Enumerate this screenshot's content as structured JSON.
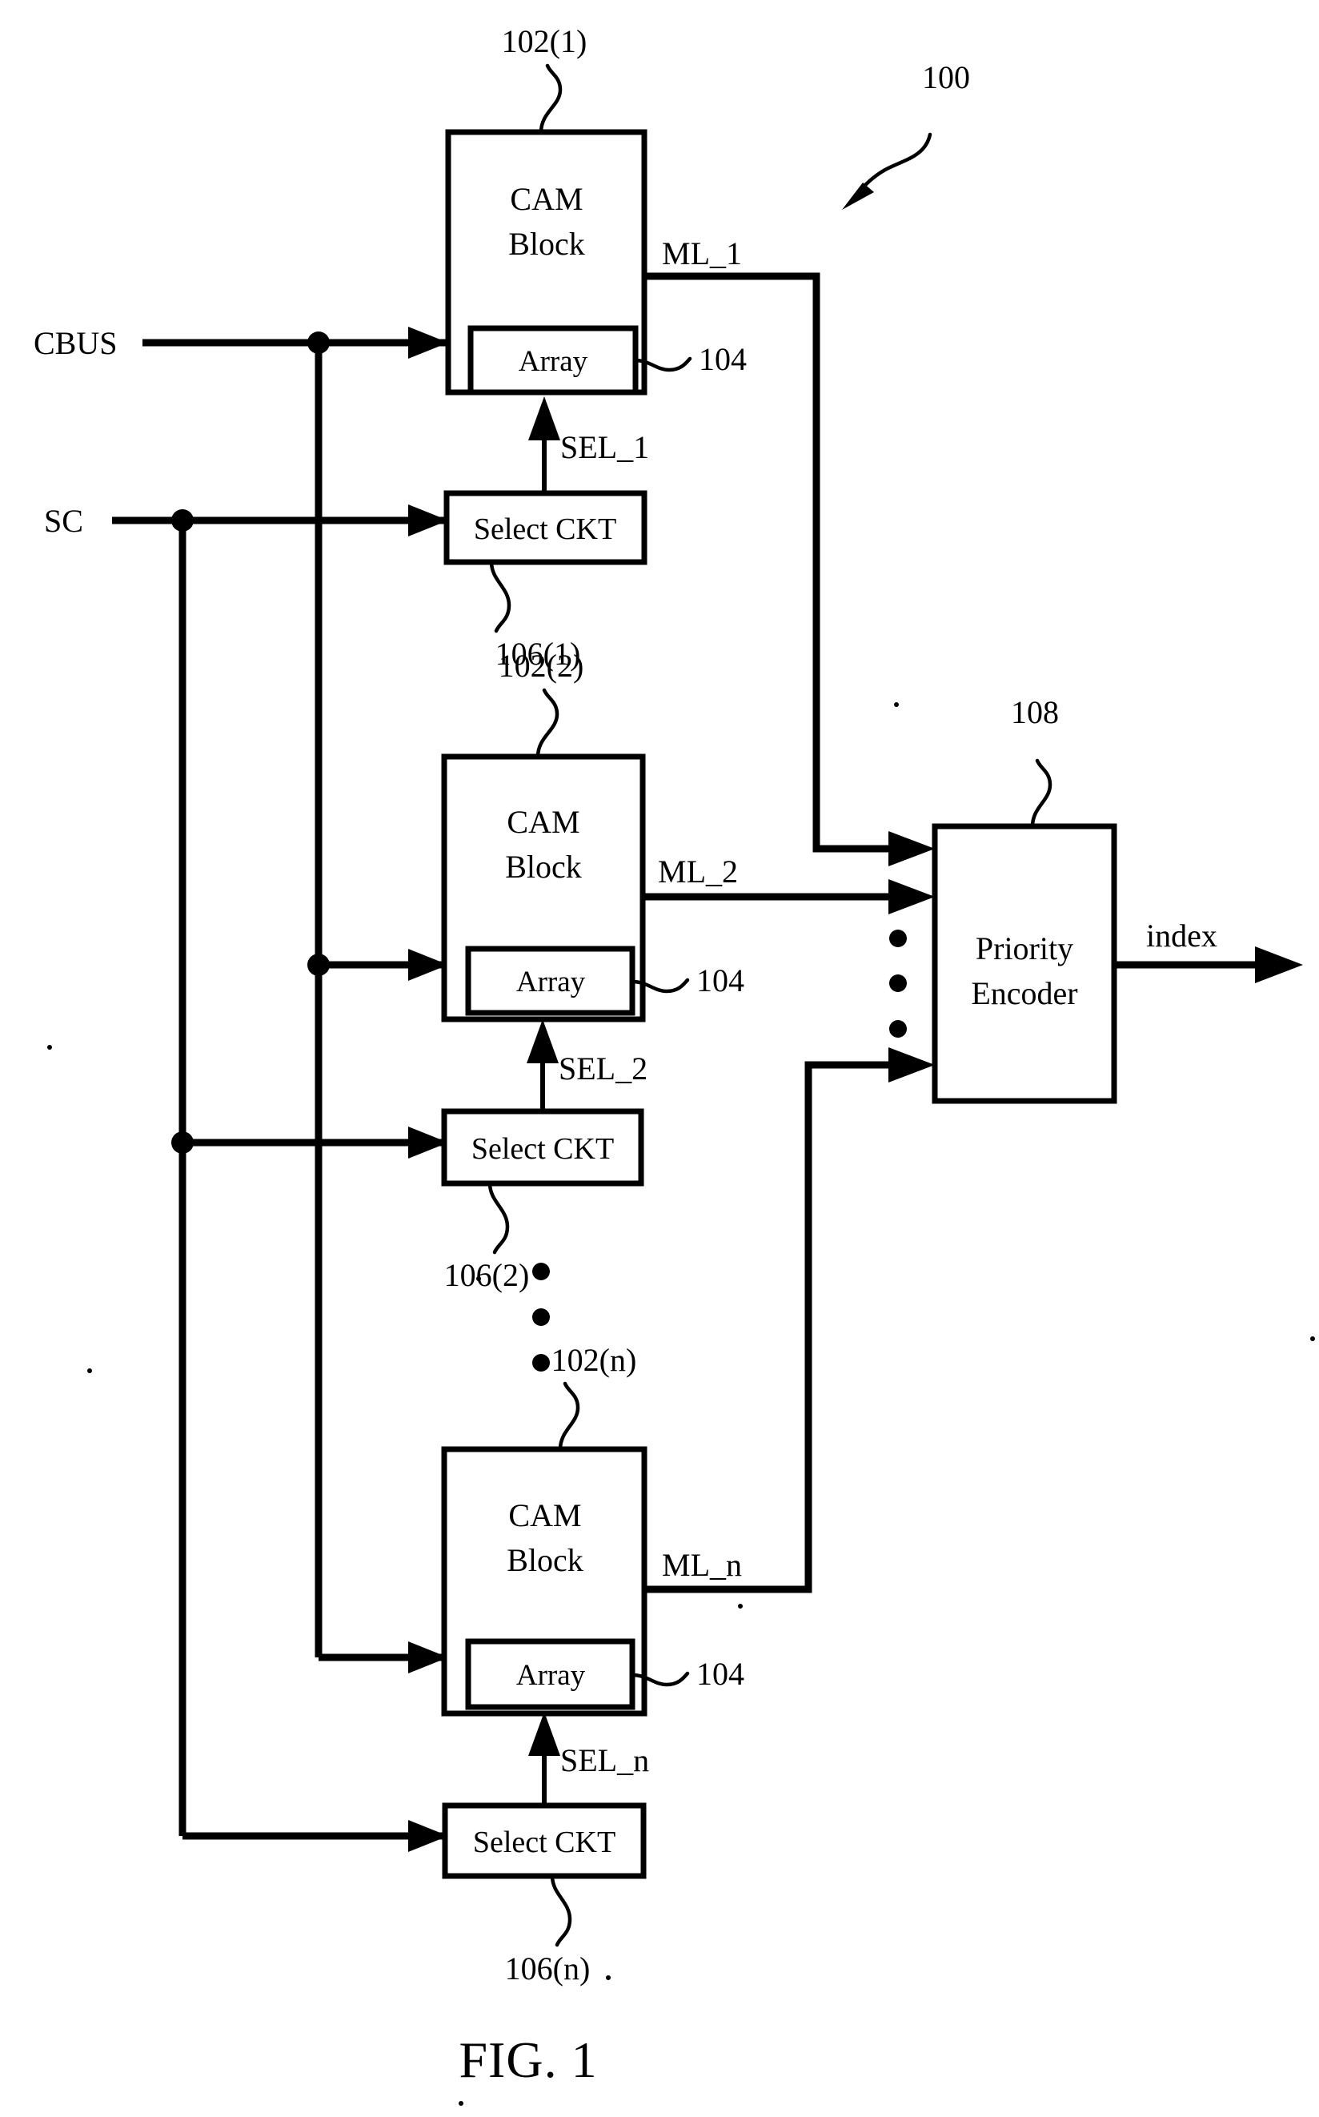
{
  "figure": {
    "caption": "FIG. 1",
    "system_ref": "100"
  },
  "ports": {
    "cbus": "CBUS",
    "sc": "SC",
    "index": "index"
  },
  "blocks": [
    {
      "id": "cam-1",
      "title_line1": "CAM",
      "title_line2": "Block",
      "ref": "102(1)",
      "array_label": "Array",
      "array_ref": "104",
      "match_line": "ML_1",
      "select_label": "Select CKT",
      "select_ref": "106(1)",
      "sel_signal": "SEL_1"
    },
    {
      "id": "cam-2",
      "title_line1": "CAM",
      "title_line2": "Block",
      "ref": "102(2)",
      "array_label": "Array",
      "array_ref": "104",
      "match_line": "ML_2",
      "select_label": "Select CKT",
      "select_ref": "106(2)",
      "sel_signal": "SEL_2"
    },
    {
      "id": "cam-n",
      "title_line1": "CAM",
      "title_line2": "Block",
      "ref": "102(n)",
      "array_label": "Array",
      "array_ref": "104",
      "match_line": "ML_n",
      "select_label": "Select CKT",
      "select_ref": "106(n)",
      "sel_signal": "SEL_n"
    }
  ],
  "encoder": {
    "title_line1": "Priority",
    "title_line2": "Encoder",
    "ref": "108",
    "output": "index"
  },
  "ellipsis": {
    "glyph": "•"
  },
  "colors": {
    "ink": "#000000",
    "paper": "#ffffff"
  }
}
